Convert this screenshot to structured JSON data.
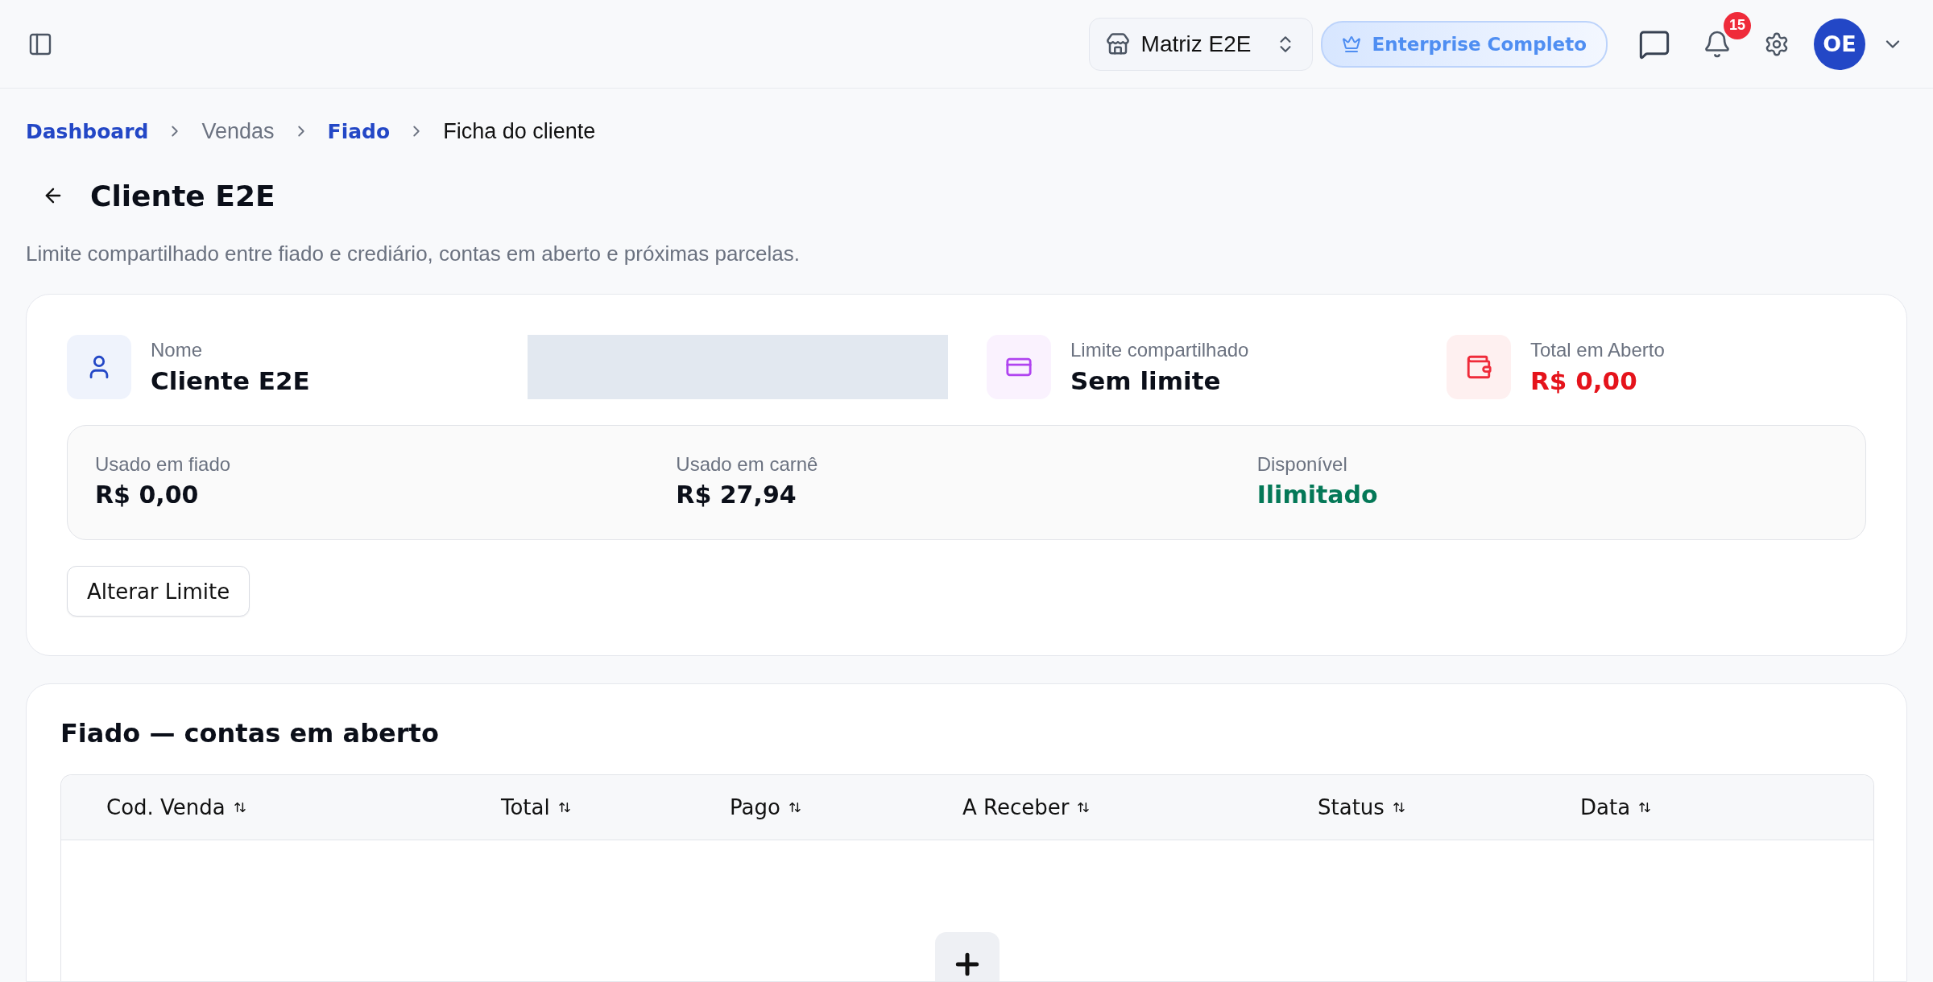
{
  "topbar": {
    "store_selector": "Matriz E2E",
    "plan_badge": "Enterprise Completo",
    "notifications_count": "15",
    "avatar_initials": "OE"
  },
  "breadcrumb": [
    {
      "label": "Dashboard",
      "kind": "link"
    },
    {
      "label": "Vendas",
      "kind": "plain"
    },
    {
      "label": "Fiado",
      "kind": "link"
    },
    {
      "label": "Ficha do cliente",
      "kind": "current"
    }
  ],
  "title": "Cliente E2E",
  "subtitle": "Limite compartilhado entre fiado e crediário, contas em aberto e próximas parcelas.",
  "client_card": {
    "fields": [
      {
        "kind": "name",
        "label": "Nome",
        "value": "Cliente E2E"
      },
      {
        "kind": "limit",
        "label": "Limite compartilhado",
        "value": "Sem limite"
      },
      {
        "kind": "total",
        "label": "Total em Aberto",
        "value": "R$ 0,00"
      }
    ],
    "summary": [
      {
        "label": "Usado em fiado",
        "value": "R$ 0,00",
        "kind": "normal"
      },
      {
        "label": "Usado em carnê",
        "value": "R$ 27,94",
        "kind": "normal"
      },
      {
        "label": "Disponível",
        "value": "Ilimitado",
        "kind": "positive"
      }
    ],
    "button": "Alterar Limite"
  },
  "fiado": {
    "title": "Fiado — contas em aberto",
    "columns": [
      "Cod. Venda",
      "Total",
      "Pago",
      "A Receber",
      "Status",
      "Data"
    ]
  }
}
